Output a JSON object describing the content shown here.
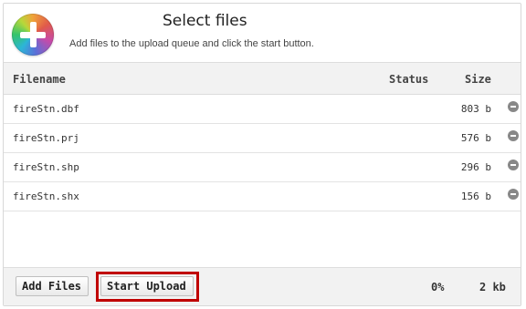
{
  "header": {
    "title": "Select files",
    "subtitle": "Add files to the upload queue and click the start button.",
    "logo_icon": "plus-circle-icon"
  },
  "columns": {
    "filename": "Filename",
    "status": "Status",
    "size": "Size"
  },
  "files": [
    {
      "name": "fireStn.dbf",
      "status": "",
      "size": "803 b",
      "remove_icon": "minus-circle-icon"
    },
    {
      "name": "fireStn.prj",
      "status": "",
      "size": "576 b",
      "remove_icon": "minus-circle-icon"
    },
    {
      "name": "fireStn.shp",
      "status": "",
      "size": "296 b",
      "remove_icon": "minus-circle-icon"
    },
    {
      "name": "fireStn.shx",
      "status": "",
      "size": "156 b",
      "remove_icon": "minus-circle-icon"
    }
  ],
  "footer": {
    "add_files_label": "Add Files",
    "start_upload_label": "Start Upload",
    "progress_percent": "0%",
    "total_size": "2 kb"
  },
  "colors": {
    "highlight": "#c00000",
    "header_bg": "#f2f2f2"
  }
}
